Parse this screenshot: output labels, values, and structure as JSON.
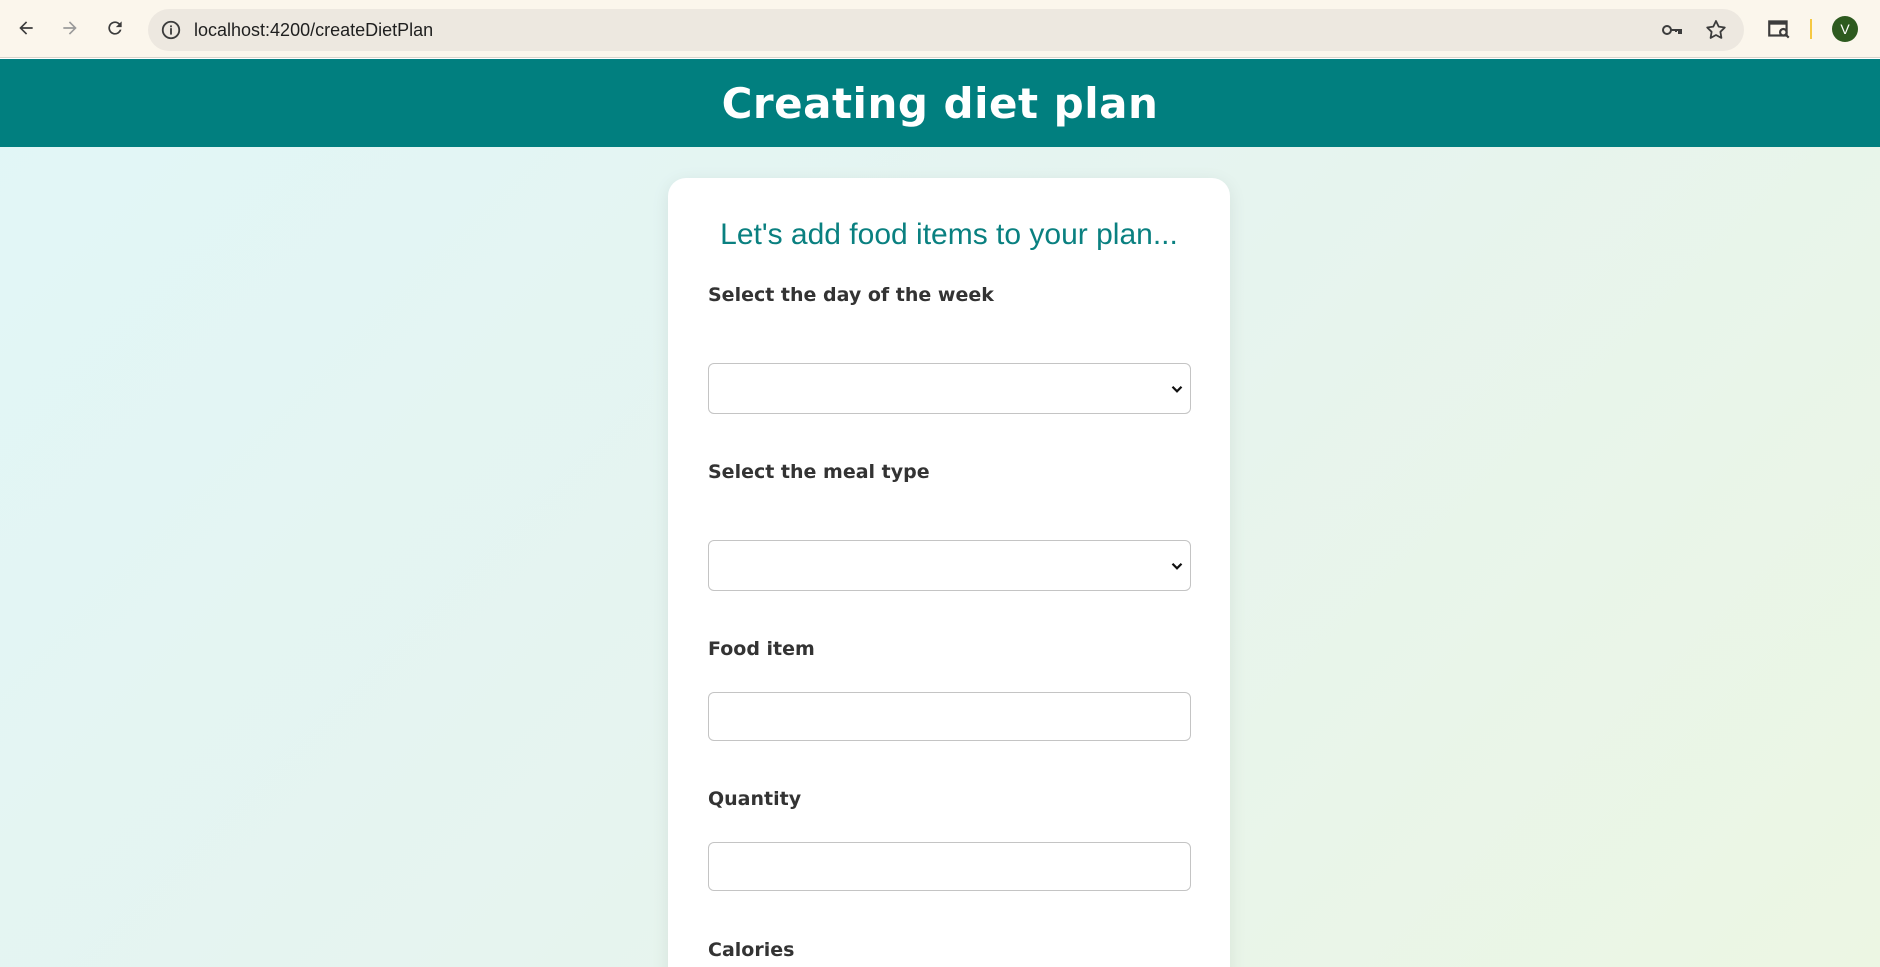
{
  "browser": {
    "url": "localhost:4200/createDietPlan",
    "avatar_initial": "V",
    "icons": [
      "back-icon",
      "forward-icon",
      "reload-icon",
      "info-icon",
      "key-icon",
      "star-icon",
      "search-tab-icon"
    ]
  },
  "header": {
    "title": "Creating diet plan",
    "background": "#017f7f"
  },
  "form": {
    "heading": "Let's add food items to your plan...",
    "day_label": "Select the day of the week",
    "day_value": "",
    "meal_label": "Select the meal type",
    "meal_value": "",
    "food_label": "Food item",
    "food_value": "",
    "quantity_label": "Quantity",
    "quantity_value": "",
    "calories_label": "Calories"
  },
  "colors": {
    "accent": "#017f7f",
    "heading_text": "#0a8080",
    "label_text": "#333333"
  }
}
